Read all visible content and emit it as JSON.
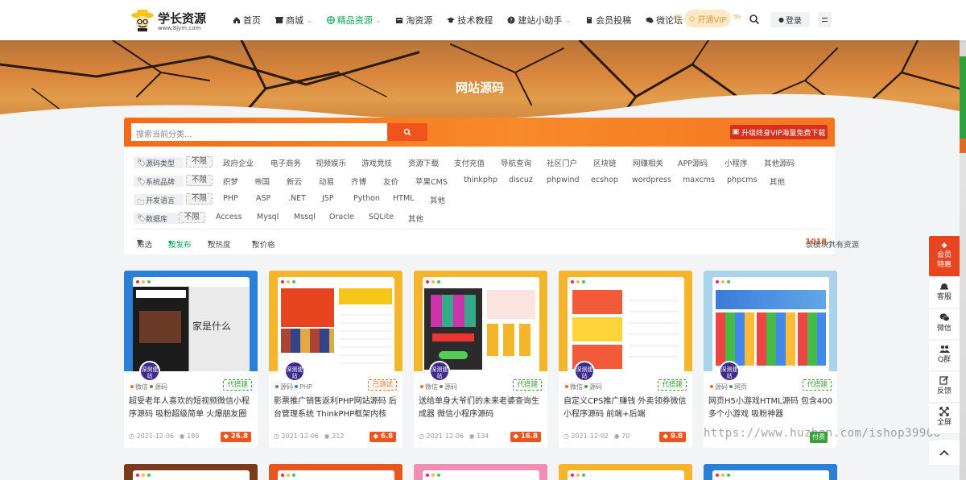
{
  "header": {
    "logo_name": "学长资源",
    "logo_url": "www.8jym.com",
    "nav": [
      {
        "label": "首页",
        "icon": "home-icon",
        "caret": false
      },
      {
        "label": "商城",
        "icon": "shop-icon",
        "caret": true
      },
      {
        "label": "精品资源",
        "icon": "globe-icon",
        "caret": true,
        "active": true
      },
      {
        "label": "淘资源",
        "icon": "box-icon",
        "caret": false
      },
      {
        "label": "技术教程",
        "icon": "graduation-icon",
        "caret": false
      },
      {
        "label": "建站小助手",
        "icon": "question-icon",
        "caret": true
      },
      {
        "label": "会员投稿",
        "icon": "book-icon",
        "caret": false
      },
      {
        "label": "微论坛",
        "icon": "chat-icon",
        "caret": false
      }
    ],
    "vip_label": "开通VIP",
    "login_label": "登录"
  },
  "hero": {
    "title": "网站源码"
  },
  "filter": {
    "search_placeholder": "搜索当前分类...",
    "vip_banner": "升级终身VIP海量免费下载",
    "rows": [
      {
        "label": "源码类型",
        "icon": "tag-icon",
        "options": [
          "不限",
          "政府企业",
          "电子商务",
          "视频娱乐",
          "游戏竞技",
          "资源下载",
          "支付充值",
          "导航查询",
          "社区门户",
          "区块链",
          "网赚相关",
          "APP源码",
          "小程序",
          "其他源码"
        ]
      },
      {
        "label": "系统品牌",
        "icon": "tag-icon",
        "options": [
          "不限",
          "织梦",
          "帝国",
          "新云",
          "动易",
          "齐博",
          "友价",
          "苹果CMS",
          "thinkphp",
          "discuz",
          "phpwind",
          "ecshop",
          "wordpress",
          "maxcms",
          "phpcms",
          "其他"
        ]
      },
      {
        "label": "开发语言",
        "icon": "folder-icon",
        "options": [
          "不限",
          "PHP",
          "ASP",
          ".NET",
          "JSP",
          "Python",
          "HTML",
          "其他"
        ]
      },
      {
        "label": "数据库",
        "icon": "tag-icon",
        "options": [
          "不限",
          "Access",
          "Mysql",
          "Mssql",
          "Oracle",
          "SQLite",
          "其他"
        ]
      }
    ],
    "sort": {
      "filter_label": "筛选",
      "by_publish": "按发布",
      "by_hot": "按热度",
      "by_price": "按价格"
    },
    "count_prefix": "该模块共有资源",
    "count_value": "1018",
    "count_suffix": "个"
  },
  "cards": [
    {
      "bg": "#2a7fd8",
      "badge": "深测建站",
      "cat1": "微信",
      "cat2": "源码",
      "tag": "代搭建",
      "tag_style": "green",
      "title": "超受老年人喜欢的短视频微信小程序源码 吸粉超级简单 火爆朋友圈",
      "date": "2021-12-06",
      "views": "180",
      "price": "26.8"
    },
    {
      "bg": "#f5b52a",
      "badge": "深测建站",
      "cat1": "源码",
      "cat2": "PHP",
      "tag": "已测试",
      "tag_style": "orange",
      "title": "影票推广销售返利PHP网站源码 后台管理系统 ThinkPHP框架内核",
      "date": "2021-12-06",
      "views": "212",
      "price": "6.8"
    },
    {
      "bg": "#f5b52a",
      "badge": "深测建站",
      "cat1": "微信",
      "cat2": "源码",
      "tag": "代搭建",
      "tag_style": "green",
      "title": "送给单身大爷们的未来老婆查询生成器 微信小程序源码",
      "date": "2021-12-06",
      "views": "134",
      "price": "16.8"
    },
    {
      "bg": "#f5b52a",
      "badge": "深测建站",
      "cat1": "微信",
      "cat2": "源码",
      "tag": "代搭建",
      "tag_style": "green",
      "title": "自定义CPS推广赚钱 外卖领券微信小程序源码 前端+后端",
      "date": "2021-12-02",
      "views": "70",
      "price": "9.8"
    },
    {
      "bg": "#a9d3ea",
      "badge": "深测建站",
      "cat1": "源码",
      "cat2": "网页",
      "tag": "代搭建",
      "tag_style": "green",
      "title": "网页H5小游戏HTML源码 包含400多个小游戏 吸粉神器",
      "date": "",
      "views": "",
      "price": ""
    }
  ],
  "stubs": [
    "#7a3b1a",
    "#e8551e",
    "#ef8fb6",
    "#f5b52a",
    "#2a7fd8"
  ],
  "sidebar": {
    "vip_label_1": "会员",
    "vip_label_2": "特惠",
    "items": [
      "客服",
      "微信",
      "Q群",
      "反馈",
      "全屏"
    ]
  },
  "watermark": "https://www.huzhan.com/ishop39968",
  "card5_footer_tag": "付费"
}
